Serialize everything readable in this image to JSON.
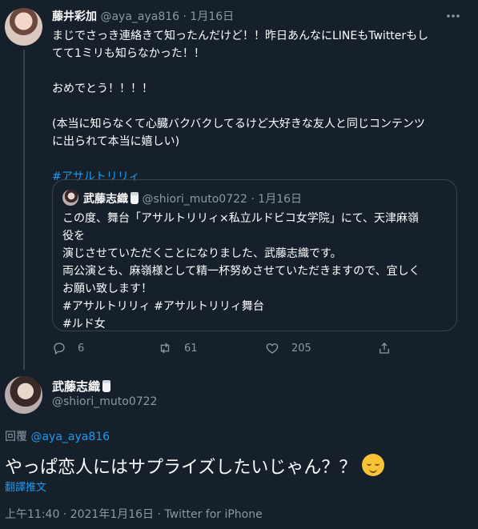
{
  "tweet": {
    "author_name": "藤井彩加",
    "handle": "@aya_aya816",
    "date": "1月16日",
    "more_icon": "more-icon",
    "lines": [
      "まじでさっき連絡きて知ったんだけど！！昨日あんなにLINEもTwitterもし",
      "てて1ミリも知らなかった！！",
      "",
      "おめでとう！！！！",
      "",
      "(本当に知らなくて心臓バクバクしてるけど大好きな友人と同じコンテンツ",
      "に出られて本当に嬉しい)"
    ],
    "hashtag": "#アサルトリリィ",
    "quote": {
      "author_name": "武藤志織",
      "handle": "@shiori_muto0722",
      "date": "1月16日",
      "lines": [
        "この度、舞台「アサルトリリィ×私立ルドビコ女学院」にて、天津麻嶺",
        "役を",
        "演じさせていただくことになりました、武藤志織です。",
        "両公演とも、麻嶺様として精一杯努めさせていただきますので、宜しく",
        "お願い致します！",
        "#アサルトリリィ #アサルトリリィ舞台",
        "#ルド女"
      ]
    },
    "actions": {
      "reply_count": "6",
      "retweet_count": "61",
      "like_count": "205"
    }
  },
  "reply": {
    "author_name": "武藤志織",
    "handle": "@shiori_muto0722",
    "replying_prefix": "回覆",
    "replying_to": "@aya_aya816",
    "text": "やっぱ恋人にはサプライズしたいじゃん？？",
    "translate": "翻譯推文",
    "meta": "上午11:40 · 2021年1月16日 · Twitter for iPhone"
  }
}
